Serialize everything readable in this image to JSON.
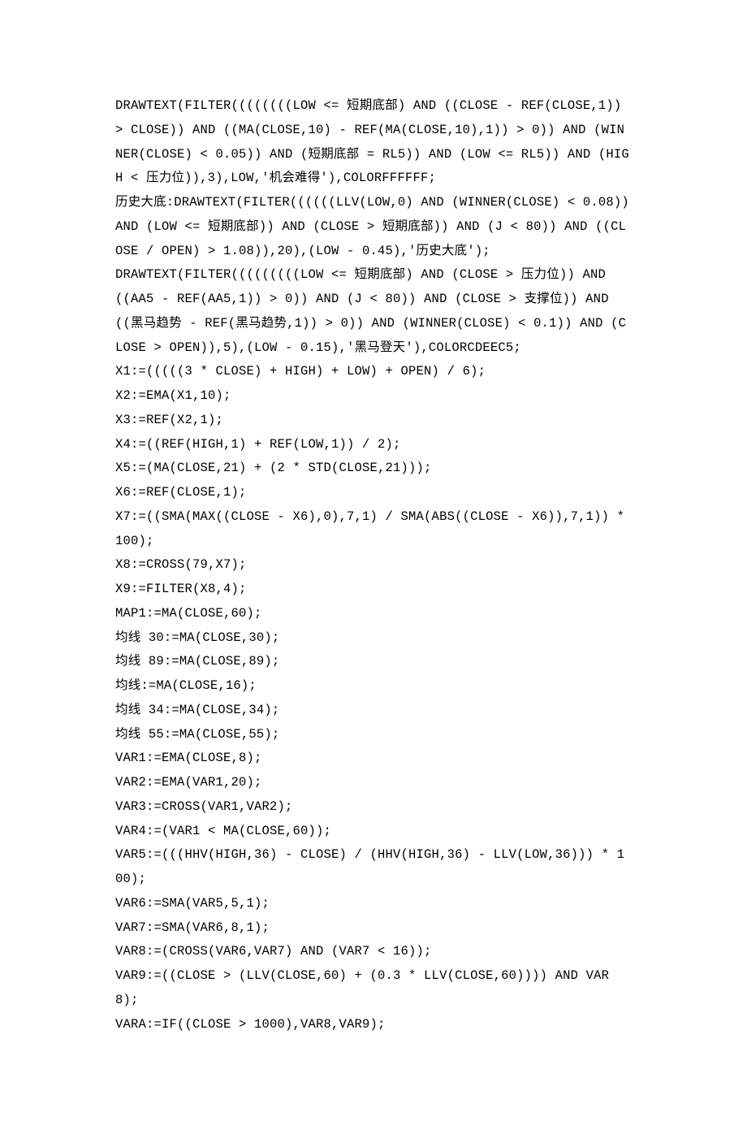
{
  "lines": [
    "DRAWTEXT(FILTER((((((((LOW <= 短期底部) AND ((CLOSE - REF(CLOSE,1)) > CLOSE)) AND ((MA(CLOSE,10) - REF(MA(CLOSE,10),1)) > 0)) AND (WINNER(CLOSE) < 0.05)) AND (短期底部 = RL5)) AND (LOW <= RL5)) AND (HIGH < 压力位)),3),LOW,'机会难得'),COLORFFFFFF;",
    "历史大底:DRAWTEXT(FILTER((((((LLV(LOW,0) AND (WINNER(CLOSE) < 0.08)) AND (LOW <= 短期底部)) AND (CLOSE > 短期底部)) AND (J < 80)) AND ((CLOSE / OPEN) > 1.08)),20),(LOW - 0.45),'历史大底');",
    "DRAWTEXT(FILTER(((((((((LOW <= 短期底部) AND (CLOSE > 压力位)) AND ((AA5 - REF(AA5,1)) > 0)) AND (J < 80)) AND (CLOSE > 支撑位)) AND ((黑马趋势 - REF(黑马趋势,1)) > 0)) AND (WINNER(CLOSE) < 0.1)) AND (CLOSE > OPEN)),5),(LOW - 0.15),'黑马登天'),COLORCDEEC5;",
    "X1:=(((((3 * CLOSE) + HIGH) + LOW) + OPEN) / 6);",
    "X2:=EMA(X1,10);",
    "X3:=REF(X2,1);",
    "X4:=((REF(HIGH,1) + REF(LOW,1)) / 2);",
    "X5:=(MA(CLOSE,21) + (2 * STD(CLOSE,21)));",
    "X6:=REF(CLOSE,1);",
    "X7:=((SMA(MAX((CLOSE - X6),0),7,1) / SMA(ABS((CLOSE - X6)),7,1)) * 100);",
    "X8:=CROSS(79,X7);",
    "X9:=FILTER(X8,4);",
    "MAP1:=MA(CLOSE,60);",
    "均线 30:=MA(CLOSE,30);",
    "均线 89:=MA(CLOSE,89);",
    "均线:=MA(CLOSE,16);",
    "均线 34:=MA(CLOSE,34);",
    "均线 55:=MA(CLOSE,55);",
    "VAR1:=EMA(CLOSE,8);",
    "VAR2:=EMA(VAR1,20);",
    "VAR3:=CROSS(VAR1,VAR2);",
    "VAR4:=(VAR1 < MA(CLOSE,60));",
    "VAR5:=(((HHV(HIGH,36) - CLOSE) / (HHV(HIGH,36) - LLV(LOW,36))) * 100);",
    "VAR6:=SMA(VAR5,5,1);",
    "VAR7:=SMA(VAR6,8,1);",
    "VAR8:=(CROSS(VAR6,VAR7) AND (VAR7 < 16));",
    "VAR9:=((CLOSE > (LLV(CLOSE,60) + (0.3 * LLV(CLOSE,60)))) AND VAR8);",
    "VARA:=IF((CLOSE > 1000),VAR8,VAR9);"
  ]
}
